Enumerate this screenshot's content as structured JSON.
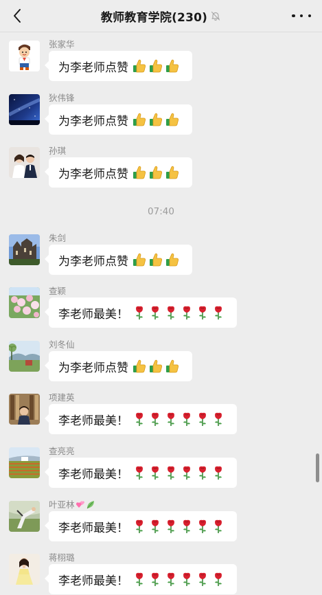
{
  "header": {
    "title": "教师教育学院(230)",
    "back_icon": "chevron-left-icon",
    "mute_icon": "bell-muted-icon",
    "more_icon": "ellipsis-icon"
  },
  "timestamp": "07:40",
  "messages": [
    {
      "sender": "张家华",
      "text": "为李老师点赞",
      "emoji": "thumbs-up",
      "count": 3
    },
    {
      "sender": "狄伟锋",
      "text": "为李老师点赞",
      "emoji": "thumbs-up",
      "count": 3
    },
    {
      "sender": "孙琪",
      "text": "为李老师点赞",
      "emoji": "thumbs-up",
      "count": 3
    },
    {
      "sender": "朱剑",
      "text": "为李老师点赞",
      "emoji": "thumbs-up",
      "count": 3
    },
    {
      "sender": "查颖",
      "text": "李老师最美！",
      "emoji": "rose",
      "count": 6
    },
    {
      "sender": "刘冬仙",
      "text": "为李老师点赞",
      "emoji": "thumbs-up",
      "count": 3
    },
    {
      "sender": "项建英",
      "text": "李老师最美！",
      "emoji": "rose",
      "count": 6
    },
    {
      "sender": "查亮亮",
      "text": "李老师最美！",
      "emoji": "rose",
      "count": 6
    },
    {
      "sender": "叶亚林",
      "text": "李老师最美！",
      "emoji": "rose",
      "count": 6,
      "name_emojis": [
        "hearts",
        "leaf"
      ]
    },
    {
      "sender": "蒋栩璐",
      "text": "李老师最美！",
      "emoji": "rose",
      "count": 6
    }
  ],
  "colors": {
    "background": "#ededed",
    "bubble": "#ffffff",
    "text": "#191919",
    "sender": "#8a8a8a"
  }
}
